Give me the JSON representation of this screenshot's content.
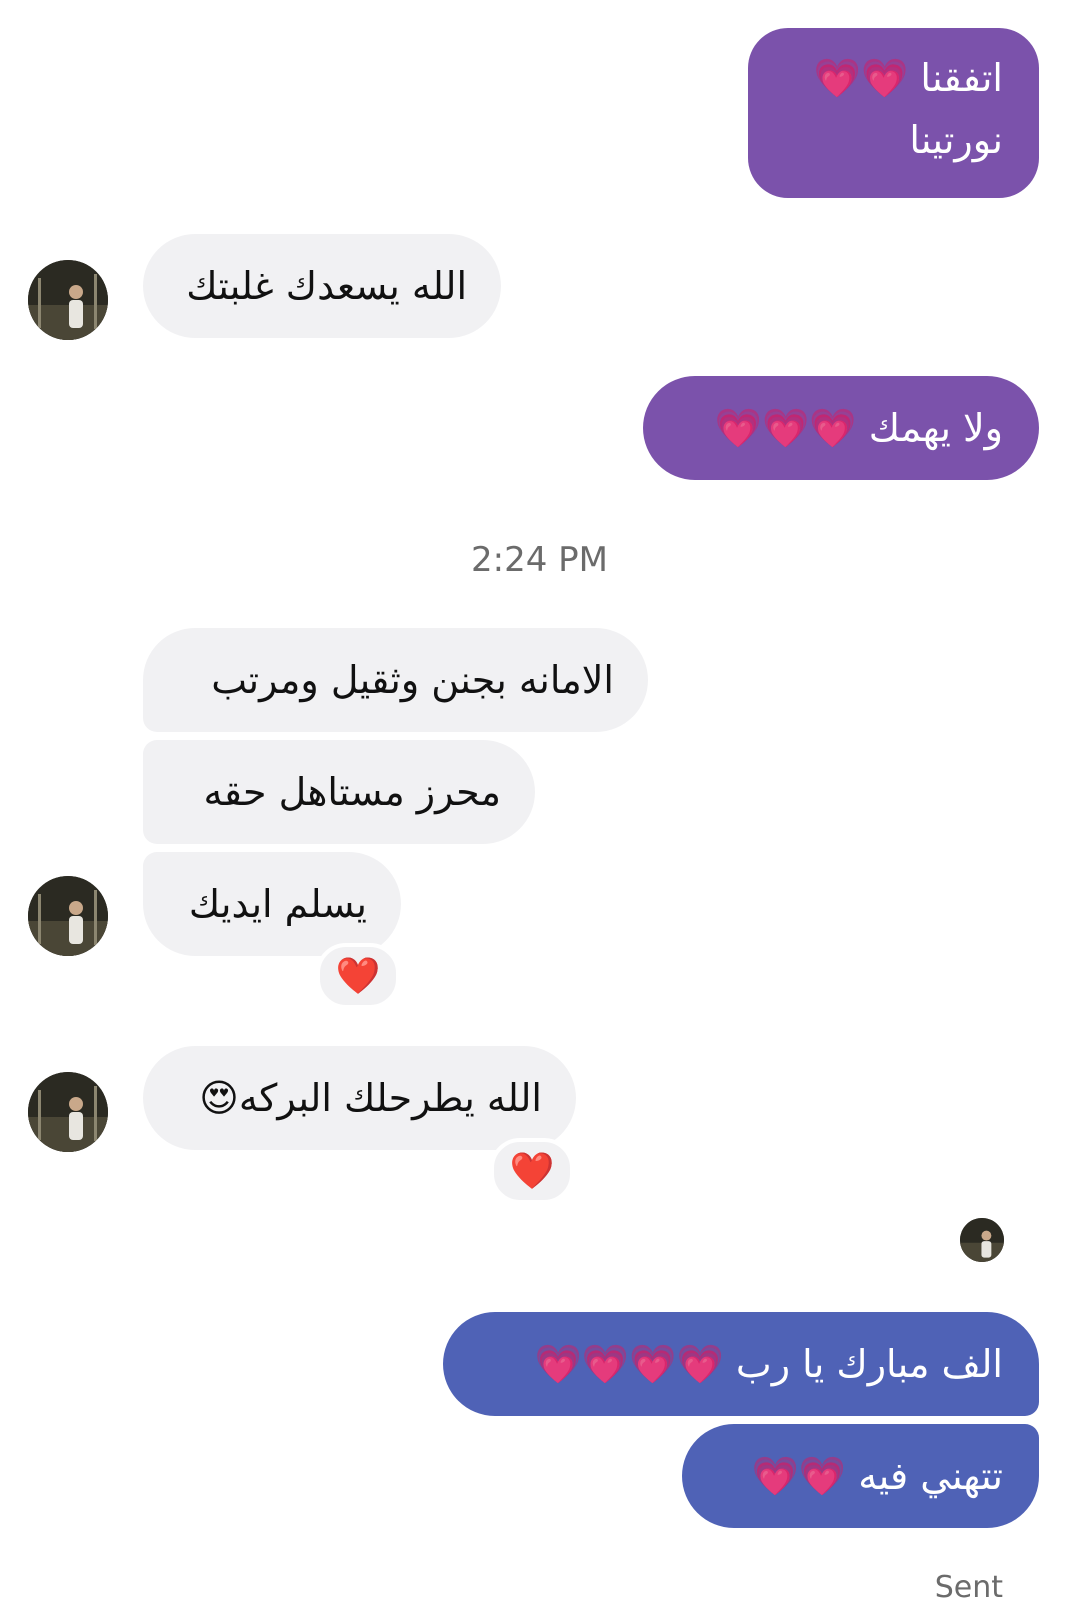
{
  "messages": [
    {
      "id": "m1",
      "direction": "outgoing",
      "lines": [
        "اتفقنا 💗💗",
        "نورتينا"
      ]
    },
    {
      "id": "m2",
      "direction": "incoming",
      "lines": [
        "الله يسعدك غلبتك"
      ]
    },
    {
      "id": "m3",
      "direction": "outgoing",
      "lines": [
        "ولا يهمك 💗💗💗"
      ]
    },
    {
      "id": "m4",
      "direction": "incoming",
      "lines": [
        "الامانه بجنن وثقيل ومرتب"
      ]
    },
    {
      "id": "m5",
      "direction": "incoming",
      "lines": [
        "محرز مستاهل حقه"
      ]
    },
    {
      "id": "m6",
      "direction": "incoming",
      "lines": [
        "يسلم ايديك"
      ],
      "reaction": "❤️"
    },
    {
      "id": "m7",
      "direction": "incoming",
      "lines": [
        "الله يطرحلك البركه😍"
      ],
      "reaction": "❤️"
    },
    {
      "id": "m8",
      "direction": "outgoing",
      "lines": [
        "الف مبارك يا رب 💗💗💗💗"
      ]
    },
    {
      "id": "m9",
      "direction": "outgoing",
      "lines": [
        "تتهني فيه 💗💗"
      ]
    }
  ],
  "timestamp": "2:24 PM",
  "status": "Sent",
  "colors": {
    "outgoing_purple": "#7b52ab",
    "outgoing_blue": "#4f62b6",
    "incoming": "#f1f1f3",
    "heart_pink": "#ff4fb0",
    "heart_red": "#e0192a"
  }
}
